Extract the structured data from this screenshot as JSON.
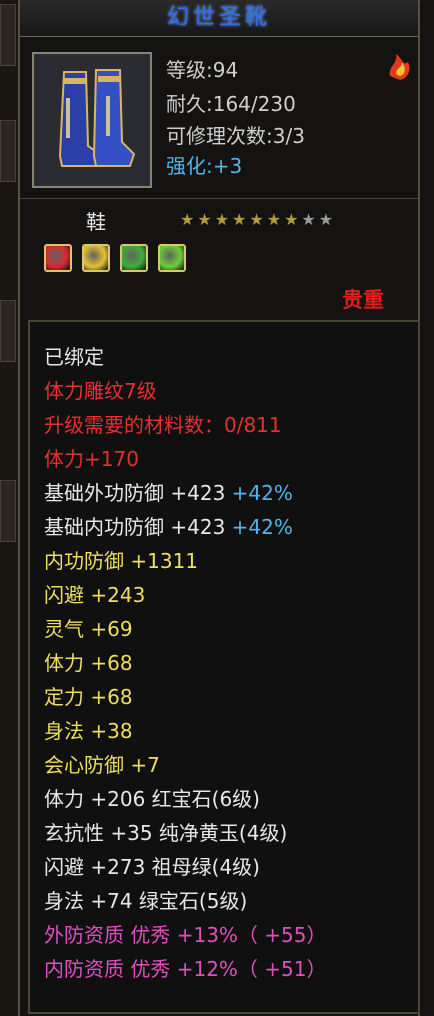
{
  "title": "幻世圣靴",
  "item_stats": {
    "level_label": "等级:94",
    "durability_label": "耐久:164/230",
    "repair_label": "可修理次数:3/3",
    "enhance_label": "强化:",
    "enhance_value": "+3"
  },
  "slot": "鞋",
  "stars": {
    "lit": 7,
    "total": 9
  },
  "gems": [
    {
      "name": "red-gem",
      "color": "#d62b2b"
    },
    {
      "name": "yellow-gem",
      "color": "#e6c234"
    },
    {
      "name": "green-gem",
      "color": "#3fae3c"
    },
    {
      "name": "emerald-gem",
      "color": "#6ccf35"
    }
  ],
  "rarity_label": "贵重",
  "lines": {
    "bound": "已绑定",
    "engrave": "体力雕纹7级",
    "materials": "升级需要的材料数：0/811",
    "stamina_bonus": "体力+170",
    "base_outer_def": "基础外功防御 +423",
    "base_outer_def_pct": "+42%",
    "base_inner_def": "基础内功防御 +423",
    "base_inner_def_pct": "+42%",
    "inner_def": "内功防御 +1311",
    "dodge": "闪避 +243",
    "spirit": "灵气 +69",
    "stamina": "体力 +68",
    "concentration": "定力 +68",
    "agility": "身法 +38",
    "crit_def": "会心防御 +7",
    "socket1": "体力 +206 红宝石(6级)",
    "socket2": "玄抗性 +35 纯净黄玉(4级)",
    "socket3": "闪避 +273 祖母绿(4级)",
    "socket4": "身法 +74 绿宝石(5级)",
    "outer_quality": "外防资质   优秀 +13%（ +55）",
    "inner_quality": "内防资质   优秀 +12%（ +51）"
  },
  "colors": {
    "title": "#2f6df0",
    "red": "#e63030",
    "yellow": "#f1de5e",
    "cyan": "#52b4ec",
    "pink": "#e04fc0"
  }
}
